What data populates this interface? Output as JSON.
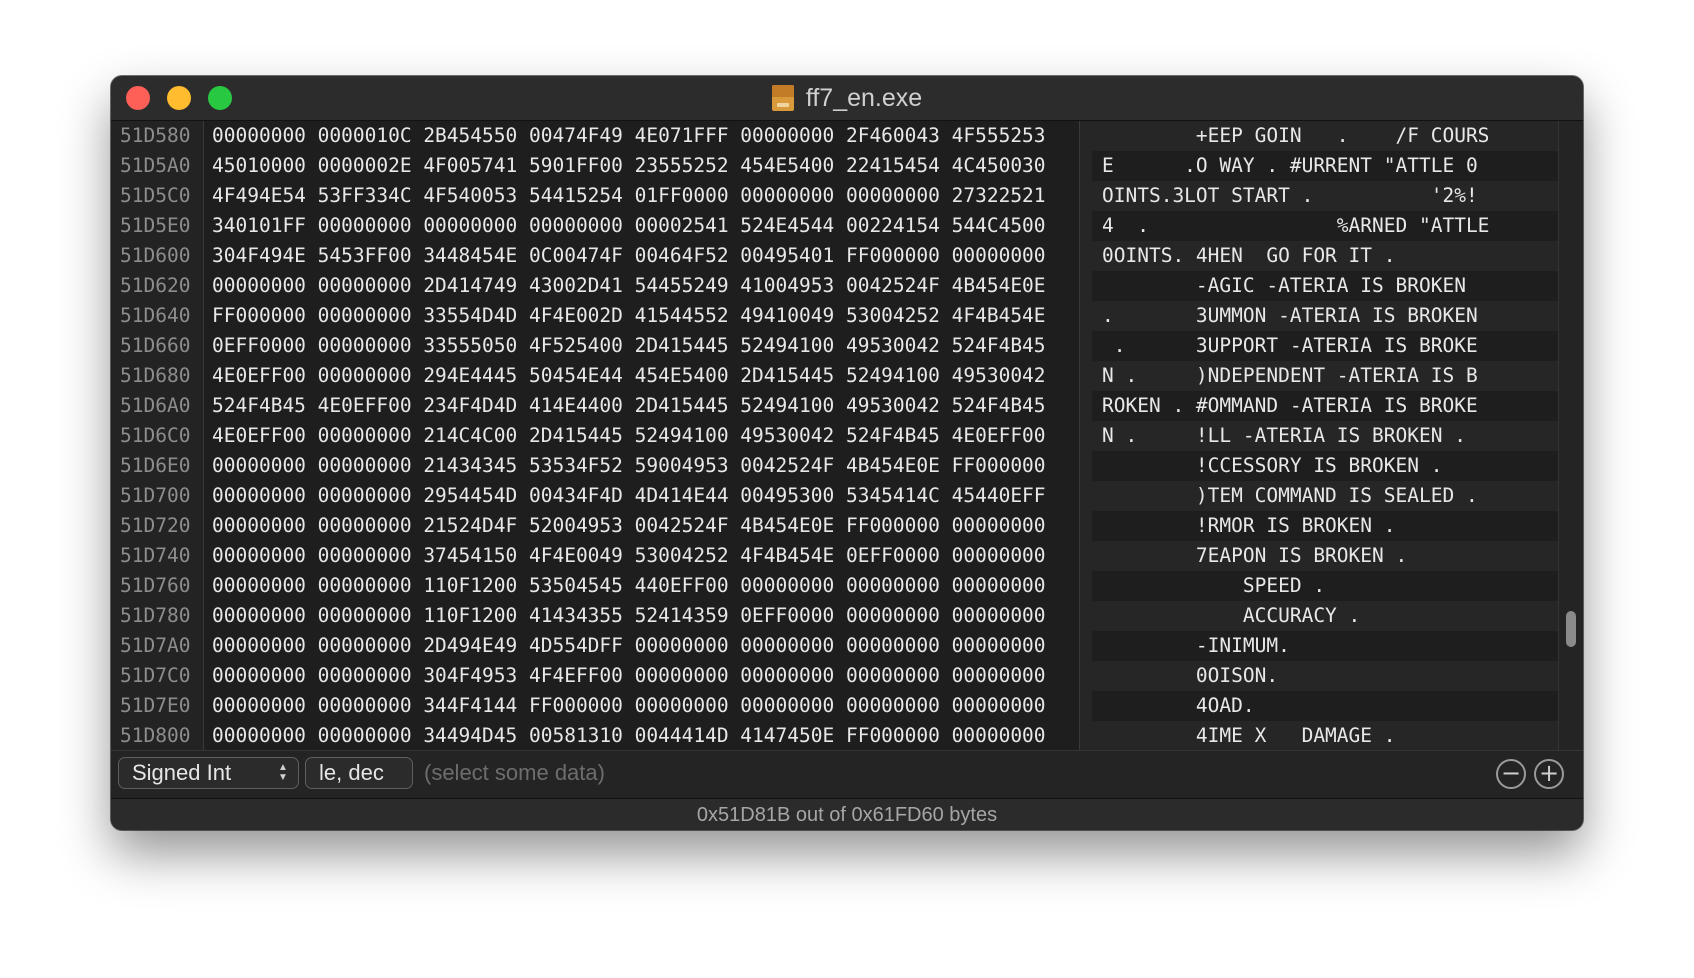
{
  "window": {
    "title": "ff7_en.exe",
    "doc_icon": "exe-document-icon"
  },
  "hex_view": {
    "offsets": [
      "51D580",
      "51D5A0",
      "51D5C0",
      "51D5E0",
      "51D600",
      "51D620",
      "51D640",
      "51D660",
      "51D680",
      "51D6A0",
      "51D6C0",
      "51D6E0",
      "51D700",
      "51D720",
      "51D740",
      "51D760",
      "51D780",
      "51D7A0",
      "51D7C0",
      "51D7E0",
      "51D800"
    ],
    "hex_rows": [
      "00000000 0000010C 2B454550 00474F49 4E071FFF 00000000 2F460043 4F555253",
      "45010000 0000002E 4F005741 5901FF00 23555252 454E5400 22415454 4C450030",
      "4F494E54 53FF334C 4F540053 54415254 01FF0000 00000000 00000000 27322521",
      "340101FF 00000000 00000000 00000000 00002541 524E4544 00224154 544C4500",
      "304F494E 5453FF00 3448454E 0C00474F 00464F52 00495401 FF000000 00000000",
      "00000000 00000000 2D414749 43002D41 54455249 41004953 0042524F 4B454E0E",
      "FF000000 00000000 33554D4D 4F4E002D 41544552 49410049 53004252 4F4B454E",
      "0EFF0000 00000000 33555050 4F525400 2D415445 52494100 49530042 524F4B45",
      "4E0EFF00 00000000 294E4445 50454E44 454E5400 2D415445 52494100 49530042",
      "524F4B45 4E0EFF00 234F4D4D 414E4400 2D415445 52494100 49530042 524F4B45",
      "4E0EFF00 00000000 214C4C00 2D415445 52494100 49530042 524F4B45 4E0EFF00",
      "00000000 00000000 21434345 53534F52 59004953 0042524F 4B454E0E FF000000",
      "00000000 00000000 2954454D 00434F4D 4D414E44 00495300 5345414C 45440EFF",
      "00000000 00000000 21524D4F 52004953 0042524F 4B454E0E FF000000 00000000",
      "00000000 00000000 37454150 4F4E0049 53004252 4F4B454E 0EFF0000 00000000",
      "00000000 00000000 110F1200 53504545 440EFF00 00000000 00000000 00000000",
      "00000000 00000000 110F1200 41434355 52414359 0EFF0000 00000000 00000000",
      "00000000 00000000 2D494E49 4D554DFF 00000000 00000000 00000000 00000000",
      "00000000 00000000 304F4953 4F4EFF00 00000000 00000000 00000000 00000000",
      "00000000 00000000 344F4144 FF000000 00000000 00000000 00000000 00000000",
      "00000000 00000000 34494D45 00581310 0044414D 4147450E FF000000 00000000"
    ],
    "ascii_rows": [
      "        +EEP GOIN   .    /F COURS",
      "E      .O WAY . #URRENT \"ATTLE 0",
      "OINTS.3LOT START .          '2%!",
      "4  .                %ARNED \"ATTLE",
      "0OINTS. 4HEN  GO FOR IT .",
      "        -AGIC -ATERIA IS BROKEN",
      ".       3UMMON -ATERIA IS BROKEN",
      " .      3UPPORT -ATERIA IS BROKE",
      "N .     )NDEPENDENT -ATERIA IS B",
      "ROKEN . #OMMAND -ATERIA IS BROKE",
      "N .     !LL -ATERIA IS BROKEN .",
      "        !CCESSORY IS BROKEN .",
      "        )TEM COMMAND IS SEALED .",
      "        !RMOR IS BROKEN .",
      "        7EAPON IS BROKEN .",
      "            SPEED .",
      "            ACCURACY .",
      "        -INIMUM.",
      "        0OISON.",
      "        4OAD.",
      "        4IME X   DAMAGE ."
    ]
  },
  "controls": {
    "type_popup": "Signed Int",
    "endian_popup": "le, dec",
    "data_placeholder": "(select some data)",
    "remove_button": "−",
    "add_button": "+"
  },
  "status": "0x51D81B out of 0x61FD60 bytes",
  "colors": {
    "close": "#fe5f57",
    "minimize": "#febc2e",
    "maximize": "#28c840",
    "background": "#1e1e1e"
  }
}
